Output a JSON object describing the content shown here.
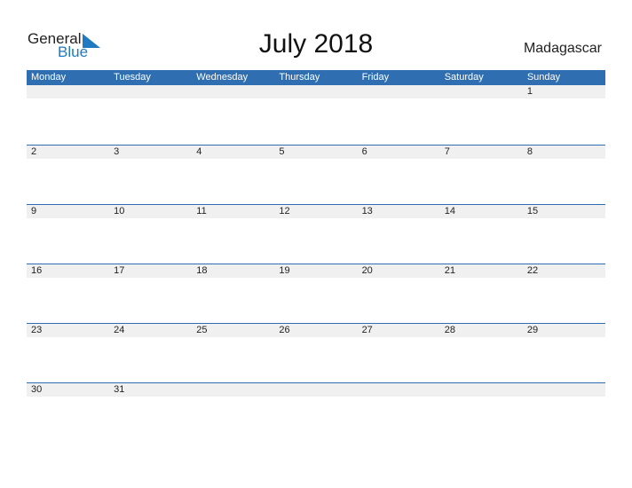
{
  "logo": {
    "text1": "General",
    "text2": "Blue"
  },
  "title": "July 2018",
  "country": "Madagascar",
  "days": [
    "Monday",
    "Tuesday",
    "Wednesday",
    "Thursday",
    "Friday",
    "Saturday",
    "Sunday"
  ],
  "weeks": [
    [
      "",
      "",
      "",
      "",
      "",
      "",
      "1"
    ],
    [
      "2",
      "3",
      "4",
      "5",
      "6",
      "7",
      "8"
    ],
    [
      "9",
      "10",
      "11",
      "12",
      "13",
      "14",
      "15"
    ],
    [
      "16",
      "17",
      "18",
      "19",
      "20",
      "21",
      "22"
    ],
    [
      "23",
      "24",
      "25",
      "26",
      "27",
      "28",
      "29"
    ],
    [
      "30",
      "31",
      "",
      "",
      "",
      "",
      ""
    ]
  ]
}
